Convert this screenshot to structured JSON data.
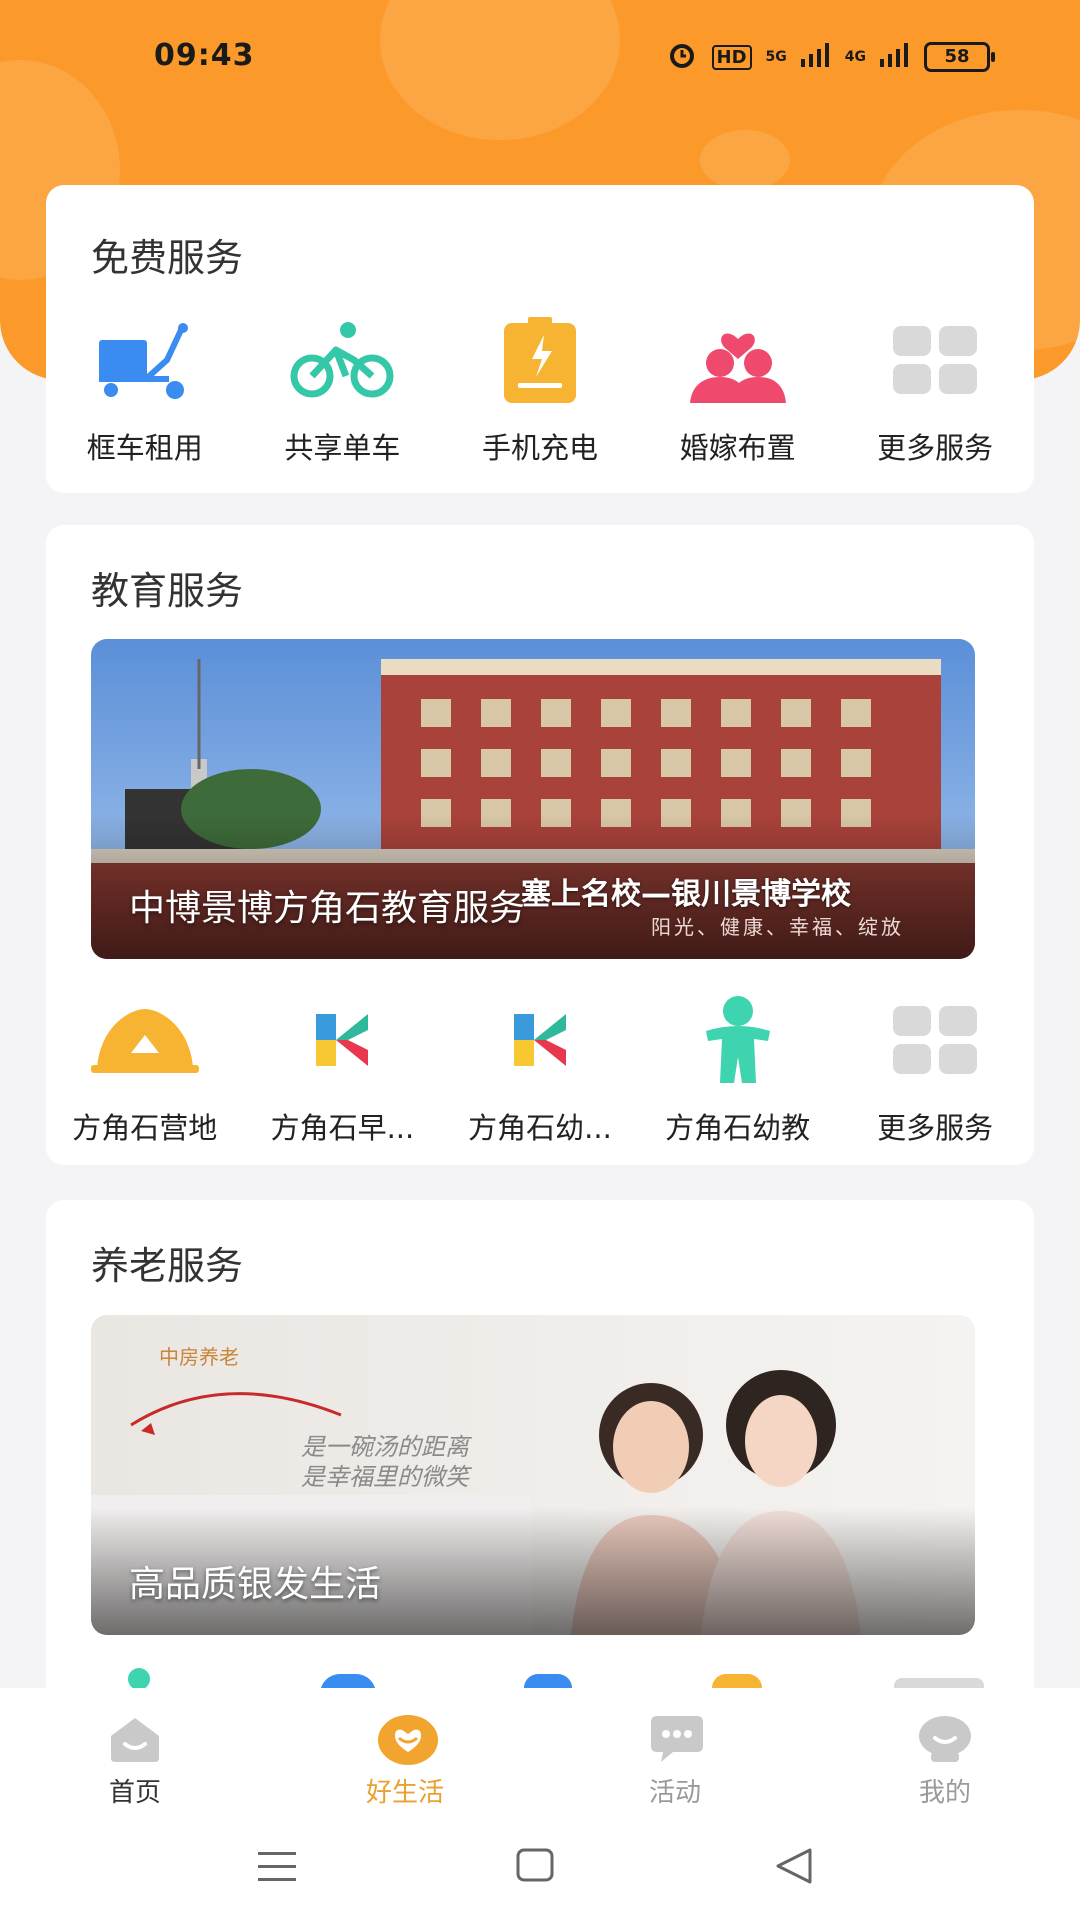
{
  "status": {
    "time": "09:43",
    "battery": "58",
    "net1": "HD",
    "net2": "5G",
    "net3": "4G"
  },
  "free_services": {
    "title": "免费服务",
    "items": [
      {
        "label": "框车租用",
        "icon": "cart-icon"
      },
      {
        "label": "共享单车",
        "icon": "bicycle-icon"
      },
      {
        "label": "手机充电",
        "icon": "battery-charge-icon"
      },
      {
        "label": "婚嫁布置",
        "icon": "couple-heart-icon"
      },
      {
        "label": "更多服务",
        "icon": "grid-more-icon"
      }
    ]
  },
  "education": {
    "title": "教育服务",
    "banner_caption": "中博景博方角石教育服务",
    "banner_slogan": "塞上名校—银川景博学校",
    "banner_sub": "阳光、健康、幸福、绽放",
    "items": [
      {
        "label": "方角石营地",
        "icon": "camp-tent-icon"
      },
      {
        "label": "方角石早...",
        "icon": "k-logo-icon"
      },
      {
        "label": "方角石幼...",
        "icon": "k-logo-icon"
      },
      {
        "label": "方角石幼教",
        "icon": "kid-figure-icon"
      },
      {
        "label": "更多服务",
        "icon": "grid-more-icon"
      }
    ]
  },
  "elderly": {
    "title": "养老服务",
    "banner_caption": "高品质银发生活",
    "banner_brand": "中房养老",
    "banner_line1": "是一碗汤的距离",
    "banner_line2": "是幸福里的微笑"
  },
  "tabbar": [
    {
      "label": "首页",
      "icon": "home-icon",
      "active": false
    },
    {
      "label": "好生活",
      "icon": "heart-bubble-icon",
      "active": true
    },
    {
      "label": "活动",
      "icon": "chat-icon",
      "active": false
    },
    {
      "label": "我的",
      "icon": "profile-icon",
      "active": false
    }
  ],
  "colors": {
    "accent": "#fb9a2a",
    "active_tab": "#e8a12f",
    "inactive_tab": "#9a9a9a"
  }
}
